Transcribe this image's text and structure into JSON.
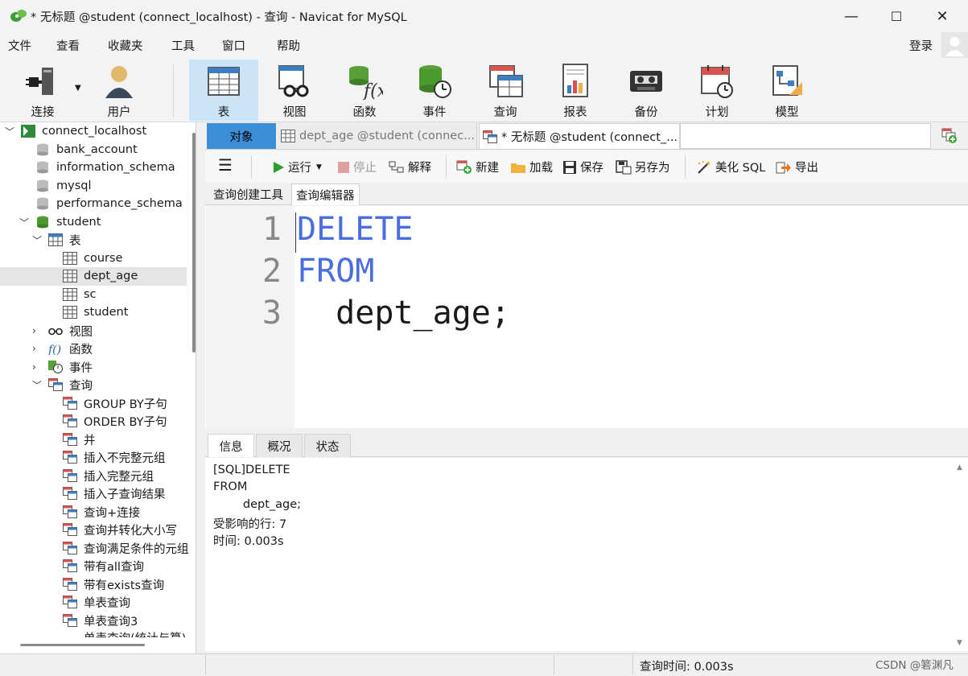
{
  "window": {
    "title": "* 无标题 @student (connect_localhost) - 查询 - Navicat for MySQL",
    "minimize_glyph": "—",
    "maximize_glyph": "☐",
    "close_glyph": "✕"
  },
  "menu": [
    "文件",
    "查看",
    "收藏夹",
    "工具",
    "窗口",
    "帮助"
  ],
  "login_label": "登录",
  "toolbar": {
    "connect": "连接",
    "user": "用户",
    "table": "表",
    "view": "视图",
    "function": "函数",
    "event": "事件",
    "query": "查询",
    "report": "报表",
    "backup": "备份",
    "schedule": "计划",
    "model": "模型"
  },
  "tree": {
    "connection": "connect_localhost",
    "databases": [
      "bank_account",
      "information_schema",
      "mysql",
      "performance_schema",
      "student"
    ],
    "tables_label": "表",
    "tables": [
      "course",
      "dept_age",
      "sc",
      "student"
    ],
    "views_label": "视图",
    "functions_label": "函数",
    "events_label": "事件",
    "queries_label": "查询",
    "queries": [
      "GROUP BY子句",
      "ORDER BY子句",
      "并",
      "插入不完整元组",
      "插入完整元组",
      "插入子查询结果",
      "查询+连接",
      "查询并转化大小写",
      "查询满足条件的元组",
      "带有all查询",
      "带有exists查询",
      "单表查询",
      "单表查询3",
      "单表查询(统计与算)"
    ]
  },
  "tabs": {
    "objects": "对象",
    "doc1": "dept_age @student (connec...",
    "doc2": "* 无标题 @student (connect_..."
  },
  "query_toolbar": {
    "menu_glyph": "☰",
    "run": "运行",
    "stop": "停止",
    "explain": "解释",
    "new": "新建",
    "load": "加载",
    "save": "保存",
    "save_as": "另存为",
    "beautify": "美化 SQL",
    "export": "导出"
  },
  "subtabs": {
    "builder": "查询创建工具",
    "editor": "查询编辑器"
  },
  "editor": {
    "line_numbers": [
      "1",
      "2",
      "3"
    ],
    "line1": "DELETE",
    "line2": "FROM",
    "line3": "  dept_age;"
  },
  "result_tabs": [
    "信息",
    "概况",
    "状态"
  ],
  "result_lines": [
    "[SQL]DELETE",
    "FROM",
    "\t\tdept_age;",
    "受影响的行: 7",
    "时间: 0.003s"
  ],
  "status": {
    "query_time": "查询时间: 0.003s",
    "watermark": "CSDN @箬渊凡"
  },
  "colors": {
    "keyword": "#4a6ee0",
    "selected_toolbar": "#cce4f7",
    "objects_tab": "#3c8fd6"
  }
}
